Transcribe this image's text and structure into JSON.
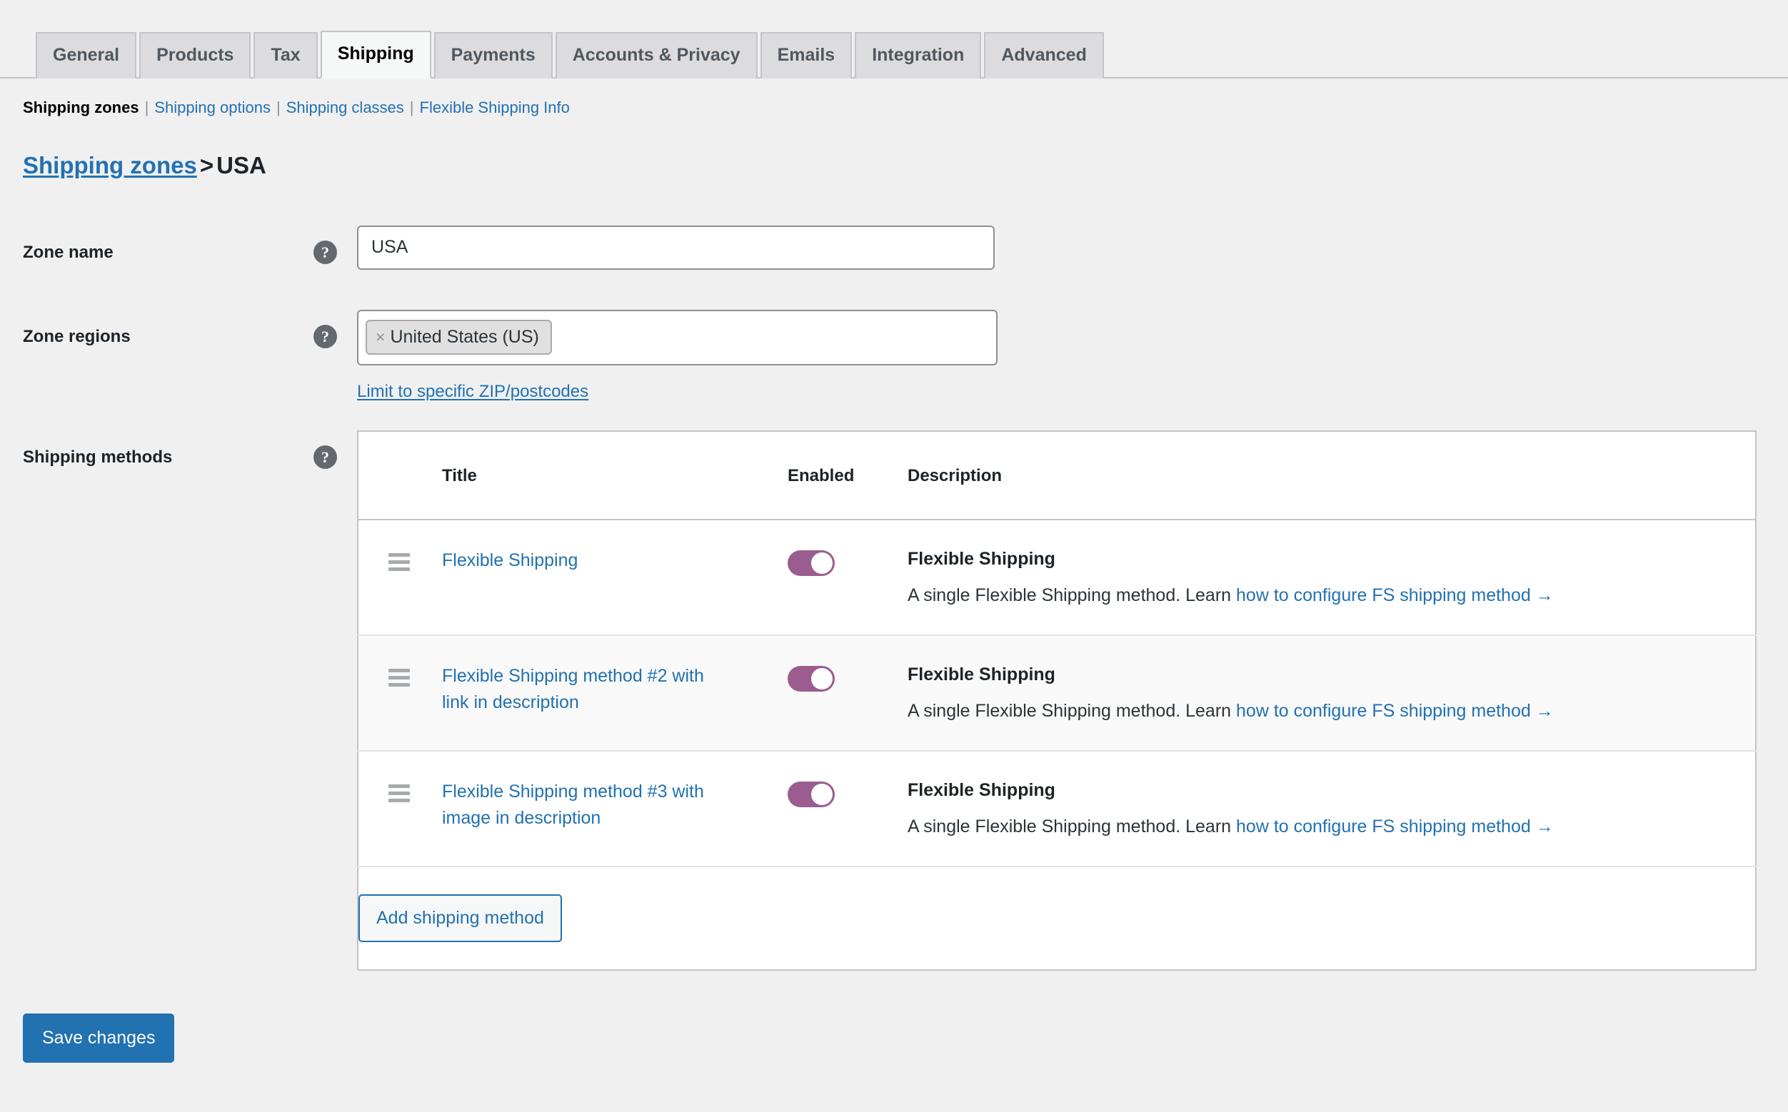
{
  "tabs": [
    {
      "label": "General",
      "active": false
    },
    {
      "label": "Products",
      "active": false
    },
    {
      "label": "Tax",
      "active": false
    },
    {
      "label": "Shipping",
      "active": true
    },
    {
      "label": "Payments",
      "active": false
    },
    {
      "label": "Accounts & Privacy",
      "active": false
    },
    {
      "label": "Emails",
      "active": false
    },
    {
      "label": "Integration",
      "active": false
    },
    {
      "label": "Advanced",
      "active": false
    }
  ],
  "subnav": [
    {
      "label": "Shipping zones",
      "current": true
    },
    {
      "label": "Shipping options",
      "current": false
    },
    {
      "label": "Shipping classes",
      "current": false
    },
    {
      "label": "Flexible Shipping Info",
      "current": false
    }
  ],
  "separator": "|",
  "breadcrumb": {
    "root_label": "Shipping zones",
    "chevron": ">",
    "current": "USA"
  },
  "help_glyph": "?",
  "zone_name": {
    "label": "Zone name",
    "value": "USA",
    "placeholder": ""
  },
  "zone_regions": {
    "label": "Zone regions",
    "chips": [
      {
        "label": "United States (US)",
        "remove_glyph": "×"
      }
    ],
    "postcode_link": "Limit to specific ZIP/postcodes"
  },
  "shipping_methods": {
    "label": "Shipping methods",
    "columns": {
      "handle": "",
      "title": "Title",
      "enabled": "Enabled",
      "description": "Description"
    },
    "rows": [
      {
        "title": "Flexible Shipping",
        "enabled": true,
        "desc_title": "Flexible Shipping",
        "desc_text": "A single Flexible Shipping method. Learn ",
        "desc_link": "how to configure FS shipping method",
        "desc_arrow": "→"
      },
      {
        "title": "Flexible Shipping method #2 with link in description",
        "enabled": true,
        "desc_title": "Flexible Shipping",
        "desc_text": "A single Flexible Shipping method. Learn ",
        "desc_link": "how to configure FS shipping method",
        "desc_arrow": "→"
      },
      {
        "title": "Flexible Shipping method #3 with image in description",
        "enabled": true,
        "desc_title": "Flexible Shipping",
        "desc_text": "A single Flexible Shipping method. Learn ",
        "desc_link": "how to configure FS shipping method",
        "desc_arrow": "→"
      }
    ],
    "add_button": "Add shipping method"
  },
  "save_button": "Save changes",
  "colors": {
    "accent_blue": "#2271b1",
    "toggle_on": "#9b5c8f",
    "page_bg": "#f0f0f1",
    "tab_inactive_bg": "#dcdcde",
    "tab_active_bg": "#f6f7f7",
    "row_alt_bg": "#f9f9f9",
    "border": "#c3c4c7"
  }
}
